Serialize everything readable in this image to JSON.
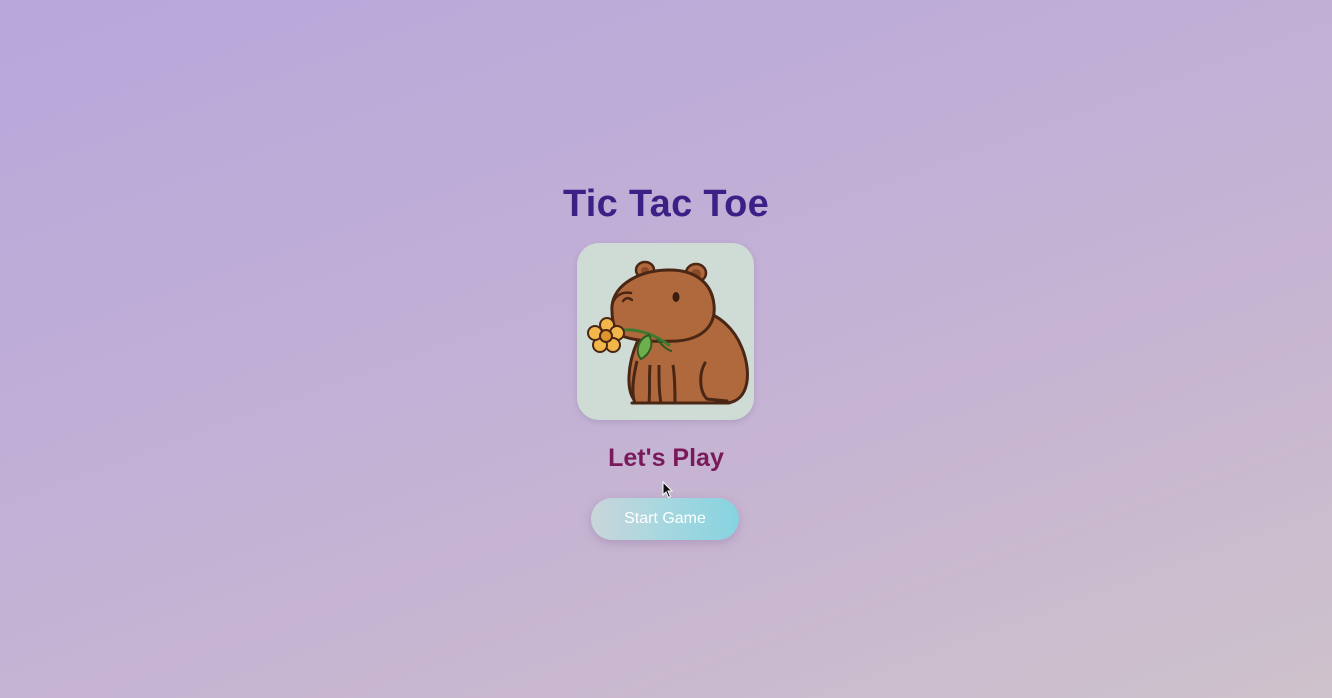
{
  "game": {
    "title": "Tic Tac Toe",
    "subtitle": "Let's Play",
    "start_button_label": "Start Game",
    "mascot_icon": "capybara-with-flower-icon"
  },
  "colors": {
    "title": "#3d1f86",
    "subtitle": "#7a1a5a",
    "button_gradient_start": "#c9d6da",
    "button_gradient_end": "#86d3e0",
    "card_background": "#cfdcd6"
  }
}
